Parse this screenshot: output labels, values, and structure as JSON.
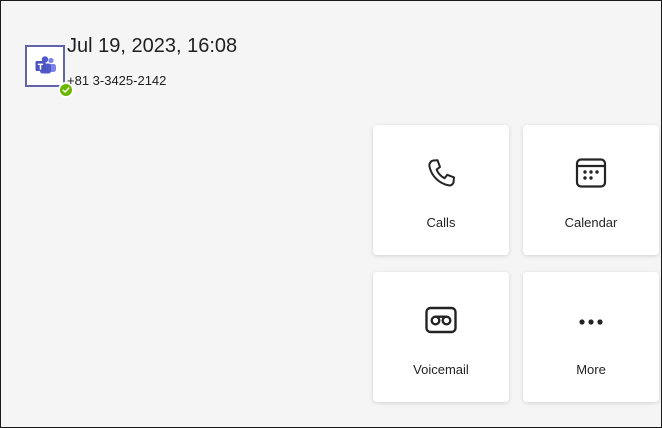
{
  "status": {
    "datetime": "Jul 19, 2023, 16:08",
    "phone_number": "+81 3-3425-2142",
    "presence": "available",
    "presence_color": "#6bb700",
    "avatar_app": "teams-icon",
    "accent": "#6264a7"
  },
  "tiles": [
    {
      "label": "Calls",
      "icon": "phone-icon"
    },
    {
      "label": "Calendar",
      "icon": "calendar-icon"
    },
    {
      "label": "Voicemail",
      "icon": "voicemail-icon"
    },
    {
      "label": "More",
      "icon": "more-icon"
    }
  ]
}
